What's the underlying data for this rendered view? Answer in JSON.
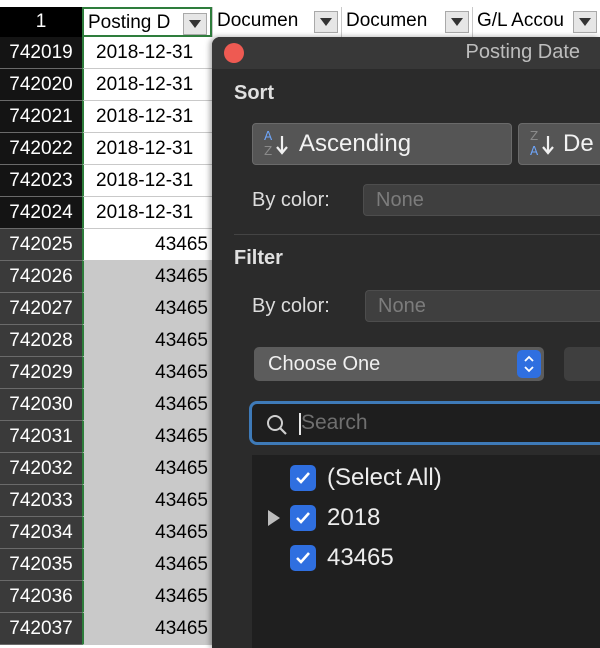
{
  "sheet": {
    "header_row_number": "1",
    "columns": [
      "Posting D",
      "Documen",
      "Documen",
      "G/L Accou"
    ],
    "rows": [
      {
        "num": "742019",
        "val": "2018-12-31"
      },
      {
        "num": "742020",
        "val": "2018-12-31"
      },
      {
        "num": "742021",
        "val": "2018-12-31"
      },
      {
        "num": "742022",
        "val": "2018-12-31"
      },
      {
        "num": "742023",
        "val": "2018-12-31"
      },
      {
        "num": "742024",
        "val": "2018-12-31"
      },
      {
        "num": "742025",
        "val": "43465"
      },
      {
        "num": "742026",
        "val": "43465"
      },
      {
        "num": "742027",
        "val": "43465"
      },
      {
        "num": "742028",
        "val": "43465"
      },
      {
        "num": "742029",
        "val": "43465"
      },
      {
        "num": "742030",
        "val": "43465"
      },
      {
        "num": "742031",
        "val": "43465"
      },
      {
        "num": "742032",
        "val": "43465"
      },
      {
        "num": "742033",
        "val": "43465"
      },
      {
        "num": "742034",
        "val": "43465"
      },
      {
        "num": "742035",
        "val": "43465"
      },
      {
        "num": "742036",
        "val": "43465"
      },
      {
        "num": "742037",
        "val": "43465"
      }
    ]
  },
  "popover": {
    "title": "Posting Date",
    "sort_heading": "Sort",
    "ascending_label": "Ascending",
    "descending_label": "De",
    "sort_bycolor_label": "By color:",
    "sort_bycolor_value": "None",
    "filter_heading": "Filter",
    "filter_bycolor_label": "By color:",
    "filter_bycolor_value": "None",
    "choose_one": "Choose One",
    "search_placeholder": "Search",
    "list_items": [
      "(Select All)",
      "2018",
      "43465"
    ]
  },
  "colors": {
    "accent_blue": "#2f6fe0",
    "selection_green": "#2e7d3c",
    "close_red": "#ee5a52"
  }
}
